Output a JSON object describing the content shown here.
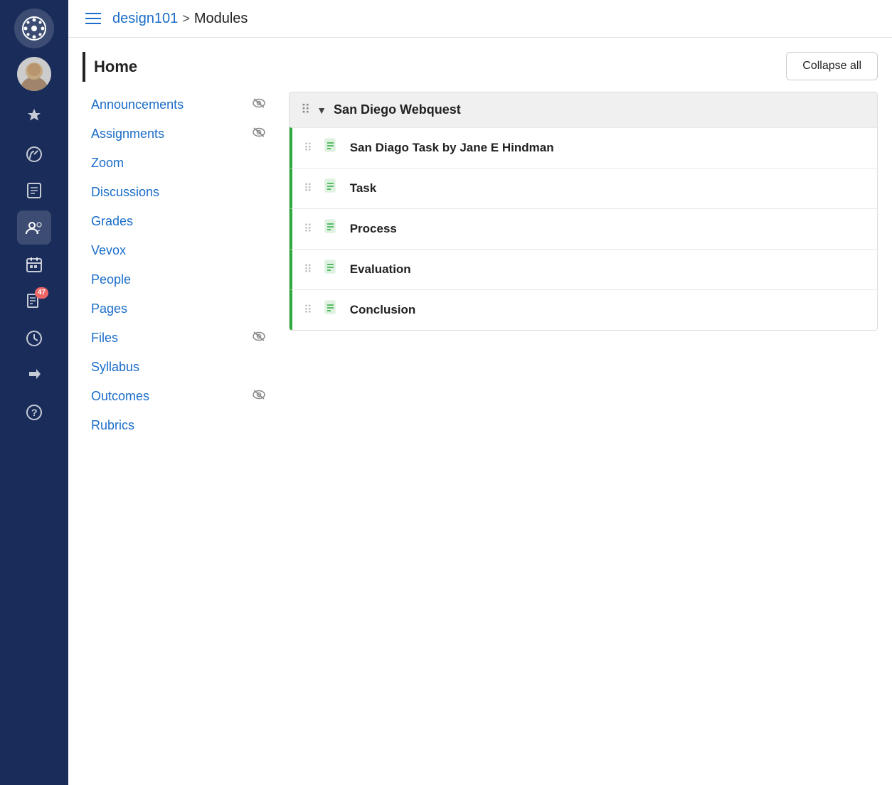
{
  "sidebar": {
    "icons": [
      {
        "name": "logo-icon",
        "symbol": "⊛",
        "active": false
      },
      {
        "name": "avatar-icon",
        "symbol": "👤",
        "active": false
      },
      {
        "name": "badge-icon",
        "symbol": "🛡",
        "active": false
      },
      {
        "name": "speedometer-icon",
        "symbol": "⏱",
        "active": false
      },
      {
        "name": "book-icon",
        "symbol": "📋",
        "active": false
      },
      {
        "name": "people-icon",
        "symbol": "👥",
        "active": true
      },
      {
        "name": "calendar-icon",
        "symbol": "📅",
        "active": false
      },
      {
        "name": "report-icon",
        "symbol": "📊",
        "active": false,
        "badge": "47"
      },
      {
        "name": "clock-icon",
        "symbol": "🕐",
        "active": false
      },
      {
        "name": "redirect-icon",
        "symbol": "↪",
        "active": false
      },
      {
        "name": "help-icon",
        "symbol": "?",
        "active": false
      }
    ]
  },
  "header": {
    "hamburger_label": "menu",
    "course_name": "design101",
    "breadcrumb_sep": ">",
    "current_page": "Modules"
  },
  "nav": {
    "home_label": "Home",
    "items": [
      {
        "label": "Announcements",
        "has_eye": true
      },
      {
        "label": "Assignments",
        "has_eye": true
      },
      {
        "label": "Zoom",
        "has_eye": false
      },
      {
        "label": "Discussions",
        "has_eye": false
      },
      {
        "label": "Grades",
        "has_eye": false
      },
      {
        "label": "Vevox",
        "has_eye": false
      },
      {
        "label": "People",
        "has_eye": false
      },
      {
        "label": "Pages",
        "has_eye": false
      },
      {
        "label": "Files",
        "has_eye": true
      },
      {
        "label": "Syllabus",
        "has_eye": false
      },
      {
        "label": "Outcomes",
        "has_eye": true
      },
      {
        "label": "Rubrics",
        "has_eye": false
      }
    ]
  },
  "modules": {
    "collapse_all_label": "Collapse all",
    "items": [
      {
        "title": "San Diego Webquest",
        "subitems": [
          {
            "title": "San Diago Task by Jane E Hindman"
          },
          {
            "title": "Task"
          },
          {
            "title": "Process"
          },
          {
            "title": "Evaluation"
          },
          {
            "title": "Conclusion"
          }
        ]
      }
    ]
  }
}
